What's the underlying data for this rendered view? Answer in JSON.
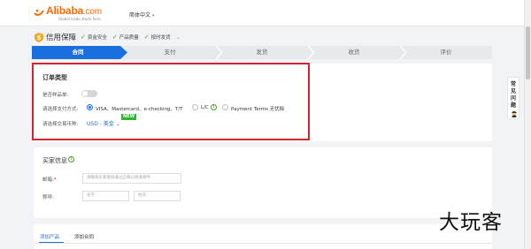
{
  "header": {
    "logo_text": "Alibaba",
    "logo_suffix": ".com",
    "logo_tagline": "Global trade starts here.",
    "language": "简体中文"
  },
  "guarantee": {
    "title": "信用保障",
    "features": [
      "资金安全",
      "产品质量",
      "按时发货"
    ]
  },
  "steps": {
    "items": [
      "合同",
      "支付",
      "发货",
      "收货",
      "评价"
    ],
    "active_index": 0
  },
  "order_type": {
    "title": "订单类型",
    "sample_label": "是否样品单:",
    "sample_enabled": false,
    "payment_label": "请选择支付方式:",
    "payment_options": [
      "VISA、Mastercard、e-checking、T/T",
      "L/C",
      "Payment Terms 无忧赊"
    ],
    "payment_selected": 0,
    "currency_label": "请选择交易币种:",
    "currency_value": "USD - 美金",
    "new_badge": "NEW"
  },
  "buyer": {
    "title": "买家信息",
    "email_label": "邮箱:",
    "email_required_mark": "*",
    "email_placeholder": "请确保买家能够通过正确以接收邮件",
    "name_label": "称呼:",
    "first_name_placeholder": "名字",
    "last_name_placeholder": "姓氏"
  },
  "product_tabs": {
    "items": [
      "添加产品",
      "添加合同"
    ],
    "active_index": 0
  },
  "faq": {
    "label": "常见问题"
  },
  "watermark": "大玩客",
  "colors": {
    "brand_orange": "#ff6a00",
    "link_blue": "#1a6fde",
    "success_green": "#4a9e2a",
    "highlight_red": "#d9222a"
  }
}
